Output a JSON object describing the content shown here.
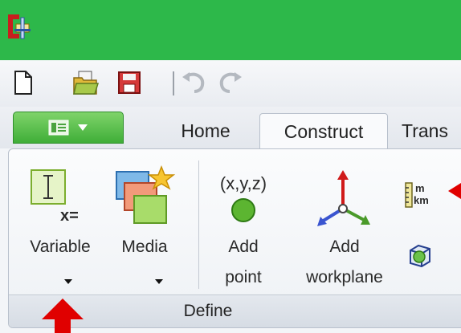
{
  "window": {
    "logo_icon": "comsol-logo-icon",
    "titlebar_color": "#2db84a"
  },
  "quick_access": [
    {
      "id": "new",
      "icon": "new-file-icon"
    },
    {
      "id": "open",
      "icon": "open-folder-icon"
    },
    {
      "id": "save",
      "icon": "save-icon"
    },
    {
      "id": "undo",
      "icon": "undo-icon"
    },
    {
      "id": "redo",
      "icon": "redo-icon"
    }
  ],
  "tabs": {
    "home": "Home",
    "construct": "Construct",
    "transform": "Trans",
    "active": "Construct"
  },
  "ribbon": {
    "variable": {
      "icon_text": "x=",
      "label": "Variable"
    },
    "media": {
      "label": "Media"
    },
    "add_point": {
      "icon_text": "(x,y,z)",
      "label1": "Add",
      "label2": "point"
    },
    "add_workplane": {
      "label1": "Add",
      "label2": "workplane"
    },
    "units_icon_text1": "m",
    "units_icon_text2": "km",
    "group_label": "Define"
  },
  "annotation_color": "#e00000"
}
